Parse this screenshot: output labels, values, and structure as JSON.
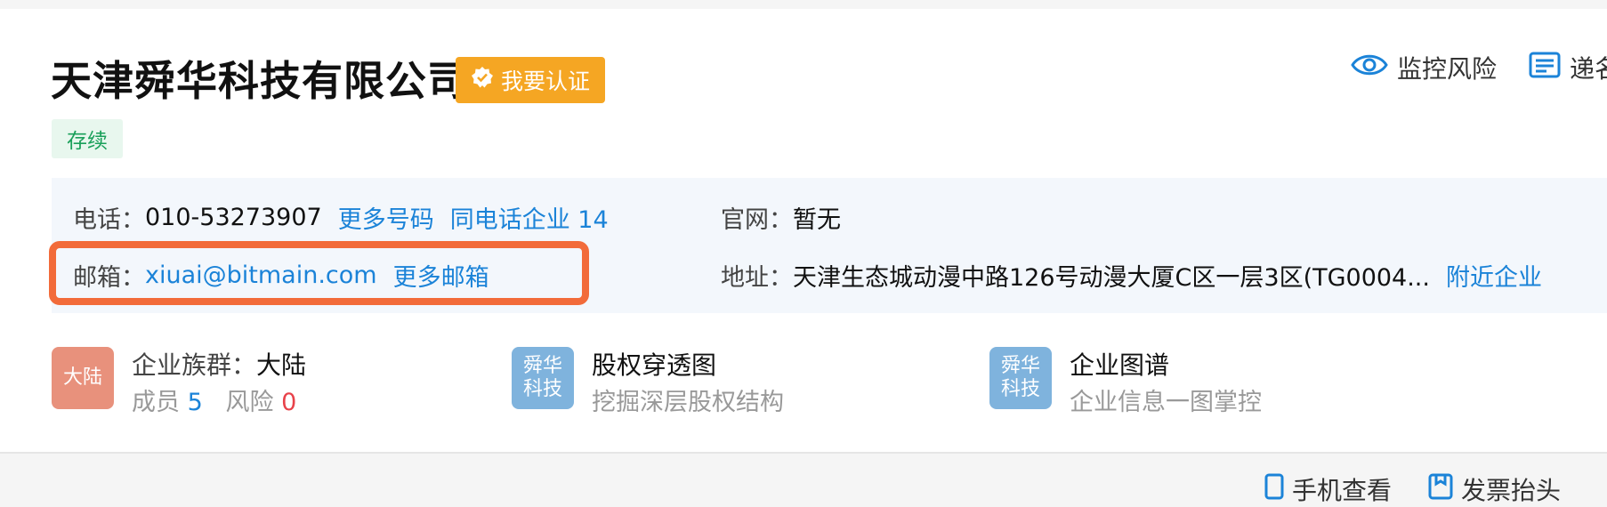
{
  "company": {
    "name": "天津舜华科技有限公司",
    "verify_label": "我要认证",
    "status": "存续"
  },
  "top_actions": {
    "monitor_label": "监控风险",
    "second_label": "递名"
  },
  "contact": {
    "phone_label": "电话：",
    "phone_value": "010-53273907",
    "more_numbers": "更多号码",
    "same_phone_label": "同电话企业 14",
    "email_label": "邮箱：",
    "email_value": "xiuai@bitmain.com",
    "more_emails": "更多邮箱",
    "website_label": "官网：",
    "website_value": "暂无",
    "address_label": "地址：",
    "address_value": "天津生态城动漫中路126号动漫大厦C区一层3区(TG0004...",
    "nearby_label": "附近企业"
  },
  "features": {
    "group": {
      "icon_text": "大陆",
      "title_label": "企业族群：",
      "title_value": "大陆",
      "members_label": "成员",
      "members_count": "5",
      "risk_label": "风险",
      "risk_count": "0"
    },
    "equity": {
      "icon_line1": "舜华",
      "icon_line2": "科技",
      "title": "股权穿透图",
      "subtitle": "挖掘深层股权结构"
    },
    "graph": {
      "icon_line1": "舜华",
      "icon_line2": "科技",
      "title": "企业图谱",
      "subtitle": "企业信息一图掌控"
    }
  },
  "bottom_actions": {
    "mobile_label": "手机查看",
    "invoice_label": "发票抬头"
  },
  "colors": {
    "brand_blue": "#1b83d8",
    "verify_orange": "#f5a623",
    "highlight_orange": "#f26b3a",
    "status_green": "#1aa05a",
    "group_icon_bg": "#e8917c",
    "company_icon_bg": "#7fb3dd",
    "risk_red": "#e8424a"
  },
  "icons": [
    "verified-badge-icon",
    "eye-icon",
    "list-icon",
    "phone-icon",
    "bookmark-icon"
  ]
}
